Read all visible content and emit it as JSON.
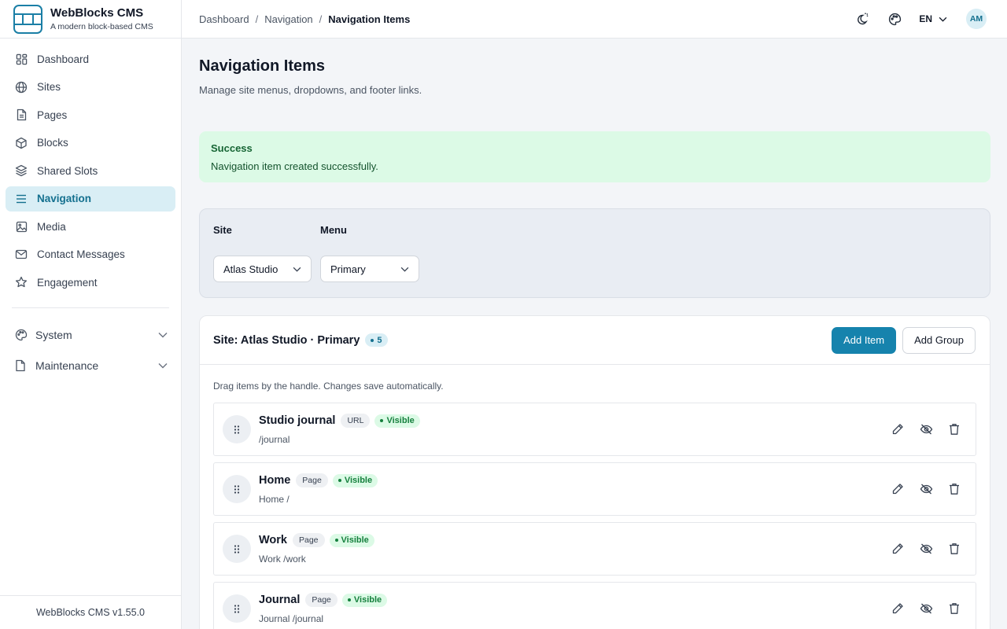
{
  "brand": {
    "name": "WebBlocks CMS",
    "tagline": "A modern block-based CMS"
  },
  "sidebar": {
    "items": [
      {
        "label": "Dashboard",
        "icon": "dashboard-icon",
        "active": false
      },
      {
        "label": "Sites",
        "icon": "globe-icon",
        "active": false
      },
      {
        "label": "Pages",
        "icon": "file-text-icon",
        "active": false
      },
      {
        "label": "Blocks",
        "icon": "cube-icon",
        "active": false
      },
      {
        "label": "Shared Slots",
        "icon": "layers-icon",
        "active": false
      },
      {
        "label": "Navigation",
        "icon": "menu-icon",
        "active": true
      },
      {
        "label": "Media",
        "icon": "image-icon",
        "active": false
      },
      {
        "label": "Contact Messages",
        "icon": "mail-icon",
        "active": false
      },
      {
        "label": "Engagement",
        "icon": "star-icon",
        "active": false
      }
    ],
    "groups": [
      {
        "label": "System",
        "icon": "palette-icon"
      },
      {
        "label": "Maintenance",
        "icon": "file-icon"
      }
    ],
    "footer": "WebBlocks CMS v1.55.0"
  },
  "topbar": {
    "breadcrumbs": [
      "Dashboard",
      "Navigation",
      "Navigation Items"
    ],
    "separator": "/",
    "language": "EN",
    "avatar_initials": "AM"
  },
  "page": {
    "title": "Navigation Items",
    "subtitle": "Manage site menus, dropdowns, and footer links."
  },
  "alert": {
    "title": "Success",
    "message": "Navigation item created successfully."
  },
  "filters": {
    "site": {
      "label": "Site",
      "value": "Atlas Studio"
    },
    "menu": {
      "label": "Menu",
      "value": "Primary"
    }
  },
  "card": {
    "title": "Site: Atlas Studio · Primary",
    "count": "5",
    "add_item_label": "Add Item",
    "add_group_label": "Add Group",
    "hint": "Drag items by the handle. Changes save automatically."
  },
  "items": [
    {
      "title": "Studio journal",
      "type": "URL",
      "visibility": "Visible",
      "sub": "/journal"
    },
    {
      "title": "Home",
      "type": "Page",
      "visibility": "Visible",
      "sub": "Home /"
    },
    {
      "title": "Work",
      "type": "Page",
      "visibility": "Visible",
      "sub": "Work /work"
    },
    {
      "title": "Journal",
      "type": "Page",
      "visibility": "Visible",
      "sub": "Journal /journal"
    }
  ],
  "colors": {
    "accent": "#1683ad",
    "accent_soft": "#d9eef5",
    "success_bg": "#dcfae6",
    "success_text": "#15803d"
  }
}
